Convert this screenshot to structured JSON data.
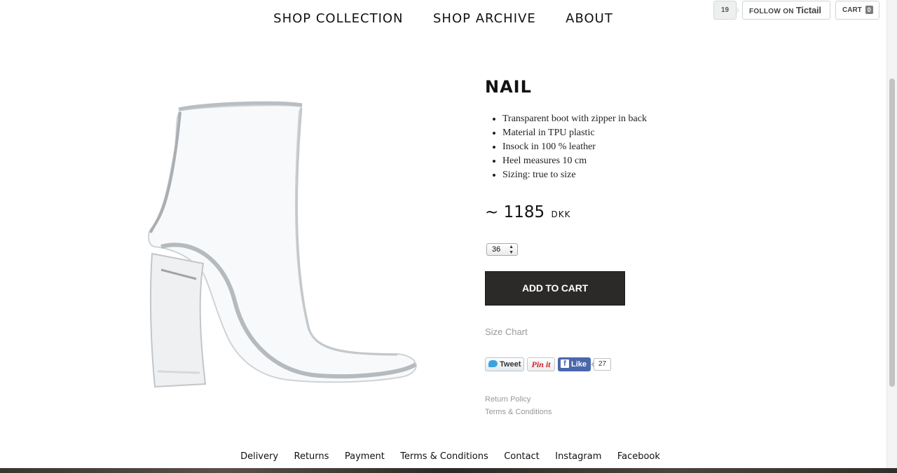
{
  "nav": {
    "items": [
      "SHOP COLLECTION",
      "SHOP ARCHIVE",
      "ABOUT"
    ]
  },
  "header": {
    "follower_count": "19",
    "follow_label": "FOLLOW ON",
    "follow_brand": "Tictail",
    "cart_label": "CART",
    "cart_count": "0"
  },
  "product": {
    "title": "NAIL",
    "image_icon": "transparent-boot-image",
    "features": [
      "Transparent boot with zipper in back",
      "Material in TPU plastic",
      "Insock in 100 % leather",
      "Heel measures 10 cm",
      "Sizing: true to size"
    ],
    "price_prefix": "~",
    "price": "1185",
    "currency": "DKK",
    "size_selected": "36",
    "add_to_cart_label": "ADD TO CART",
    "size_chart_label": "Size Chart"
  },
  "social": {
    "tweet_label": "Tweet",
    "pin_label": "Pin it",
    "like_label": "Like",
    "like_count": "27"
  },
  "policies": {
    "return_policy": "Return Policy",
    "terms": "Terms & Conditions"
  },
  "footer": {
    "links": [
      "Delivery",
      "Returns",
      "Payment",
      "Terms & Conditions",
      "Contact",
      "Instagram",
      "Facebook"
    ]
  },
  "colors": {
    "button_dark": "#2c2a28",
    "facebook_blue": "#4a66ad",
    "pinterest_red": "#c8232c",
    "twitter_blue": "#3aa3e0"
  }
}
